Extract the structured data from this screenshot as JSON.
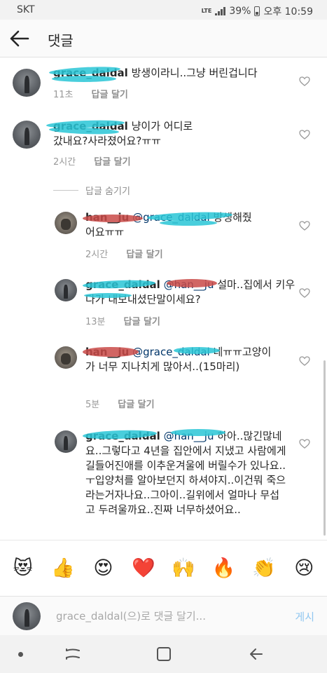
{
  "status_bar": {
    "carrier": "SKT",
    "network": "LTE",
    "battery": "39%",
    "time": "오후 10:59"
  },
  "header": {
    "title": "댓글"
  },
  "comments": [
    {
      "username": "grace_daldal",
      "text": " 방생이라니..그냥 버린겁니다",
      "time": "11초",
      "reply_label": "답글 달기",
      "avatar": "person-photo"
    },
    {
      "username": "grace_daldal",
      "text": " 냥이가 어디로 갔내요?사라졌어요?ㅠㅠ",
      "time": "2시간",
      "reply_label": "답글 달기",
      "avatar": "person-photo"
    }
  ],
  "hide_replies_label": "답글 숨기기",
  "replies": [
    {
      "username": "han__ju",
      "mention": " @grace_daldal",
      "text": " 방생해줬어요ㅠㅠ",
      "time": "2시간",
      "reply_label": "답글 달기",
      "avatar": "cat-photo"
    },
    {
      "username": "grace_daldal",
      "mention": " @han__ju",
      "text": " 설마..집에서 키우다가 내보내셨단말이세요?",
      "time": "13분",
      "reply_label": "답글 달기",
      "avatar": "person-photo"
    },
    {
      "username": "han__ju",
      "mention": " @grace_daldal",
      "text": " 네ㅠㅠ고양이가 너무 지나치게 많아서..(15마리)",
      "time": "5분",
      "reply_label": "답글 달기",
      "avatar": "cat-photo"
    },
    {
      "username": "grace_daldal",
      "mention": " @han__ju",
      "text": " 하아..많긴많네요..그렇다고 4년을 집안에서 지냈고 사람에게 길들어진애를 이추운겨울에 버릴수가 있나요..ㅜ입양처를 알아보던지 하셔야지..이건뭐 죽으라는거자나요..그아이..길위에서 얼마나 무섭고 두려울까요..진짜 너무하셨어요..",
      "time": "",
      "reply_label": "",
      "avatar": "person-photo"
    }
  ],
  "emoji_bar": [
    "😻",
    "👍",
    "😍",
    "❤️",
    "🙌",
    "🔥",
    "👏",
    "😢"
  ],
  "input_bar": {
    "placeholder": "grace_daldal(으)로 댓글 달기...",
    "post_label": "게시"
  },
  "nav_bar": {
    "icons": [
      "dot-icon",
      "recent-apps-icon",
      "home-icon",
      "back-icon"
    ]
  },
  "colors": {
    "link": "#003569",
    "meta": "#999999",
    "post_disabled": "#8fc6f0",
    "redaction_cyan": "#29c5d6",
    "redaction_red": "#c94a48"
  }
}
